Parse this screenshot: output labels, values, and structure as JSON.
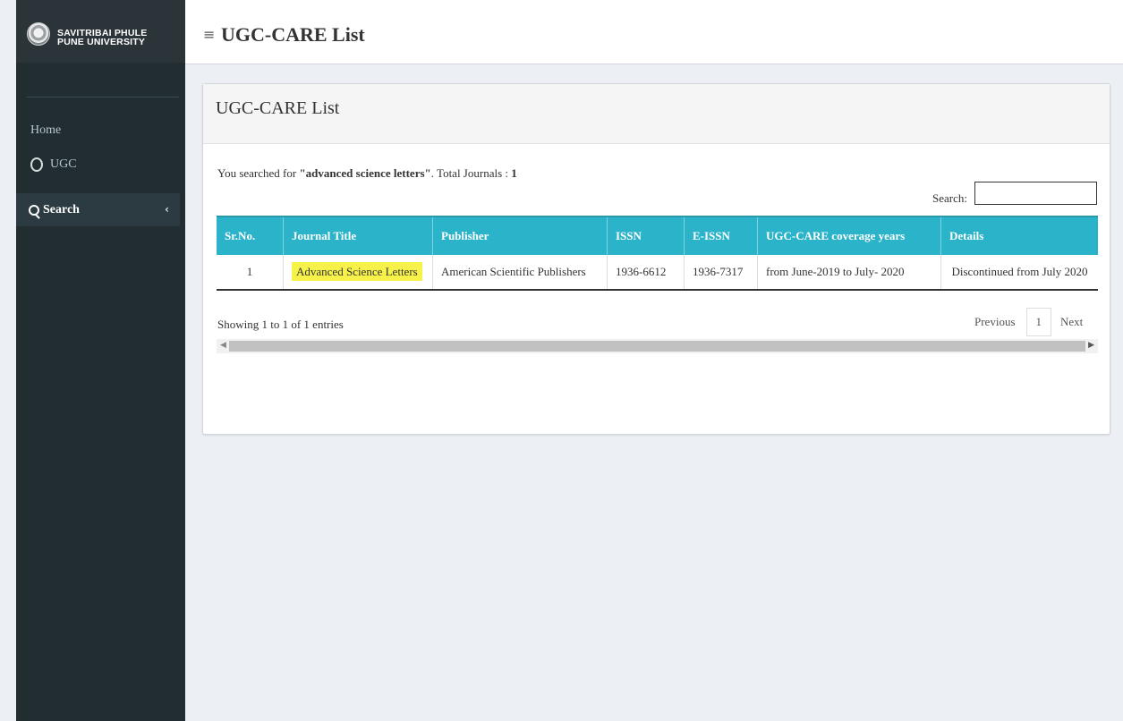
{
  "brand": {
    "line1": "SAVITRIBAI PHULE",
    "line2": "PUNE UNIVERSITY"
  },
  "sidebar": {
    "home": "Home",
    "ugc": "UGC",
    "search": "Search"
  },
  "header": {
    "title": "UGC-CARE List"
  },
  "box": {
    "title": "UGC-CARE List",
    "search_prefix": "You searched for ",
    "search_term": "\"advanced science letters\"",
    "search_suffix": ". Total Journals : ",
    "total": "1",
    "search_label": "Search:",
    "search_value": ""
  },
  "table": {
    "headers": [
      "Sr.No.",
      "Journal Title",
      "Publisher",
      "ISSN",
      "E-ISSN",
      "UGC-CARE coverage years",
      "Details"
    ],
    "rows": [
      {
        "sr": "1",
        "title": "Advanced Science Letters",
        "publisher": "American Scientific Publishers",
        "issn": "1936-6612",
        "eissn": "1936-7317",
        "coverage": "from June-2019 to July- 2020",
        "details": "Discontinued from July 2020"
      }
    ]
  },
  "footer": {
    "showing": "Showing 1 to 1 of 1 entries",
    "previous": "Previous",
    "page": "1",
    "next": "Next"
  }
}
